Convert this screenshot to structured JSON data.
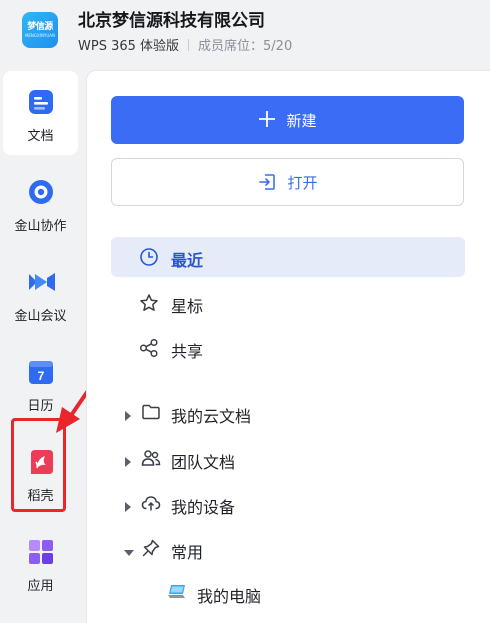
{
  "header": {
    "logo_text": "梦信源",
    "logo_sub": "MENGXINYUAN",
    "org_name": "北京梦信源科技有限公司",
    "edition": "WPS 365 体验版",
    "seats": "成员席位：5/20"
  },
  "rail": {
    "items": [
      {
        "label": "文档",
        "icon": "document-icon"
      },
      {
        "label": "金山协作",
        "icon": "kingsoft-collab-icon"
      },
      {
        "label": "金山会议",
        "icon": "video-meeting-icon"
      },
      {
        "label": "日历",
        "icon": "calendar-icon",
        "day": "7"
      },
      {
        "label": "稻壳",
        "icon": "docer-icon"
      },
      {
        "label": "应用",
        "icon": "apps-icon"
      }
    ],
    "active_index": 0,
    "highlighted_index": 4
  },
  "main": {
    "new_label": "新建",
    "open_label": "打开",
    "nav": [
      {
        "label": "最近",
        "icon": "clock-icon"
      },
      {
        "label": "星标",
        "icon": "star-icon"
      },
      {
        "label": "共享",
        "icon": "share-icon"
      }
    ],
    "nav_active_index": 0,
    "tree": [
      {
        "label": "我的云文档",
        "icon": "folder-icon",
        "expanded": false
      },
      {
        "label": "团队文档",
        "icon": "team-icon",
        "expanded": false
      },
      {
        "label": "我的设备",
        "icon": "cloud-device-icon",
        "expanded": false
      },
      {
        "label": "常用",
        "icon": "pin-icon",
        "expanded": true
      },
      {
        "label": "我的电脑",
        "icon": "computer-icon"
      }
    ]
  },
  "colors": {
    "accent": "#3b6cf6",
    "highlight_red": "#e8262c",
    "active_bg": "#e6ebf9"
  }
}
